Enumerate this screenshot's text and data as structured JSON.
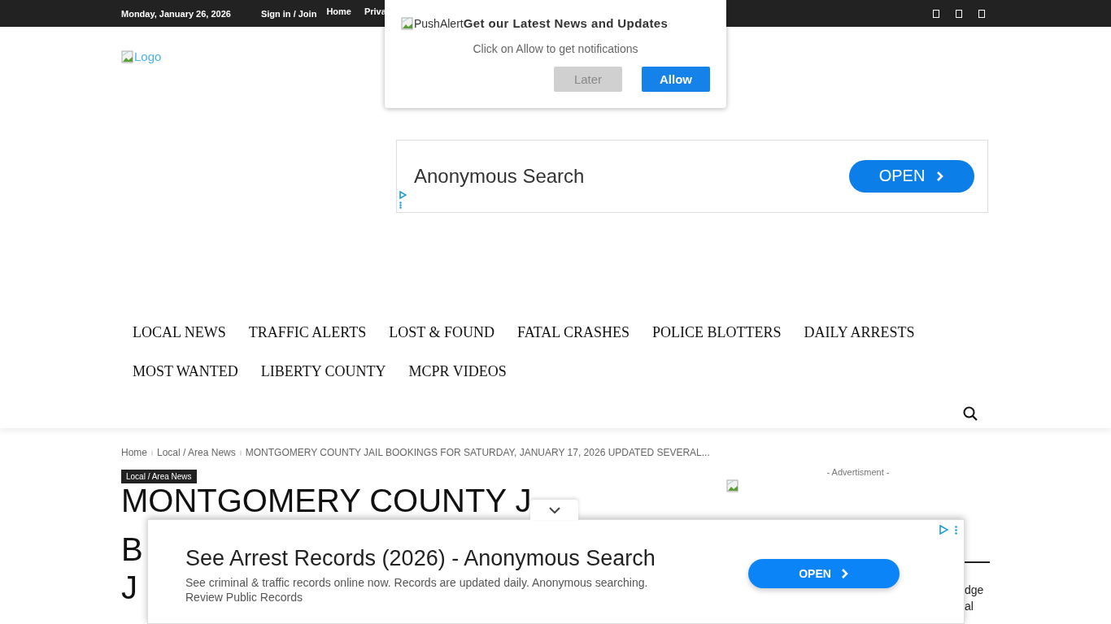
{
  "top_bar": {
    "date": "Monday, January 26, 2026",
    "sign_in": "Sign in / Join",
    "links": [
      "Home",
      "Priva"
    ]
  },
  "logo": {
    "alt": "Logo"
  },
  "header_ad": {
    "headline": "Anonymous Search",
    "button": "OPEN"
  },
  "nav": {
    "items": [
      "LOCAL NEWS",
      "TRAFFIC ALERTS",
      "LOST & FOUND",
      "FATAL CRASHES",
      "POLICE BLOTTERS",
      "DAILY ARRESTS",
      "MOST WANTED",
      "LIBERTY COUNTY",
      "MCPR VIDEOS"
    ]
  },
  "breadcrumbs": [
    "Home",
    "Local / Area News",
    "MONTGOMERY COUNTY JAIL BOOKINGS FOR SATURDAY, JANUARY 17, 2026 UPDATED SEVERAL..."
  ],
  "category_tag": "Local / Area News",
  "article_title_lines": [
    "MONTGOMERY COUNTY J",
    "B",
    "J"
  ],
  "sidebar": {
    "ad_label": "- Advertisment -",
    "text_lines": [
      "dge",
      "al"
    ]
  },
  "push_alert": {
    "image_alt": "PushAlert",
    "title": "Get our Latest News and Updates",
    "message": "Click on Allow to get notifications",
    "buttons": [
      {
        "label": "Later",
        "kind": "secondary"
      },
      {
        "label": "Allow",
        "kind": "primary"
      }
    ]
  },
  "bottom_ad": {
    "headline": "See Arrest Records (2026) - Anonymous Search",
    "description": "See criminal & traffic records online now. Records are updated daily. Anonymous searching.",
    "link": "Review Public Records",
    "button": "OPEN"
  }
}
